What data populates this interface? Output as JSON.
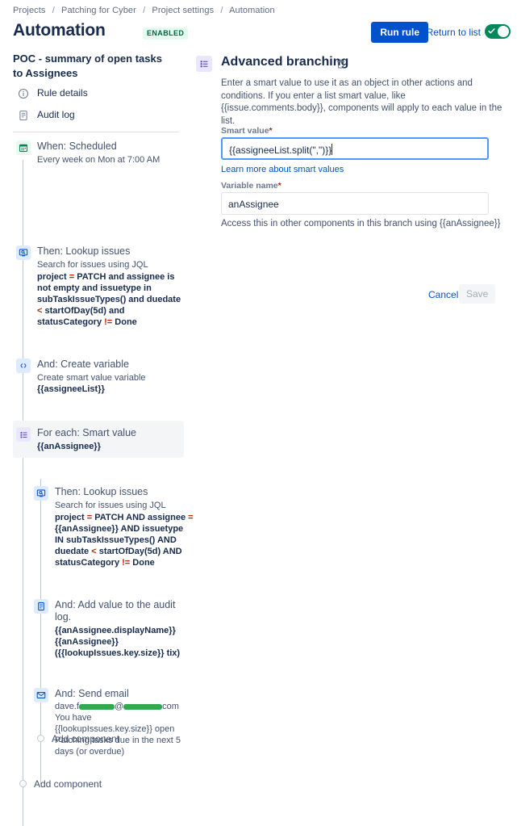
{
  "breadcrumb": {
    "items": [
      "Projects",
      "Patching for Cyber",
      "Project settings",
      "Automation"
    ],
    "separator": "/"
  },
  "header": {
    "title": "Automation",
    "status_badge": "ENABLED",
    "run_rule_label": "Run rule",
    "return_to_list_label": "Return to list",
    "toggle_state": "on",
    "primary_color": "#0052cc",
    "enabled_badge_bg": "#e3fcef",
    "enabled_badge_fg": "#006644",
    "toggle_on_color": "#00875a"
  },
  "rule": {
    "name": "POC - summary of open tasks to Assignees",
    "nav": [
      {
        "label": "Rule details",
        "icon": "info-circle-icon"
      },
      {
        "label": "Audit log",
        "icon": "document-icon"
      }
    ],
    "components": [
      {
        "title": "When: Scheduled",
        "sub": "Every week on Mon at 7:00 AM",
        "icon": "calendar-icon"
      },
      {
        "title": "Then: Lookup issues",
        "sub": "Search for issues using JQL",
        "jql_parts": [
          {
            "t": "project ",
            "op": false
          },
          {
            "t": "=",
            "op": true
          },
          {
            "t": " PATCH and assignee is not empty and issuetype in subTaskIssueTypes() and duedate ",
            "op": false
          },
          {
            "t": "<",
            "op": true
          },
          {
            "t": " startOfDay(5d) and statusCategory ",
            "op": false
          },
          {
            "t": "!=",
            "op": true
          },
          {
            "t": " Done",
            "op": false
          }
        ],
        "icon": "lookup-issues-icon"
      },
      {
        "title": "And: Create variable",
        "sub": "Create smart value variable",
        "strong": "{{assigneeList}}",
        "icon": "curly-braces-icon"
      },
      {
        "title": "For each: Smart value",
        "strong": "{{anAssignee}}",
        "icon": "branching-icon",
        "selected": true
      }
    ],
    "nested_components": [
      {
        "title": "Then: Lookup issues",
        "sub": "Search for issues using JQL",
        "jql_parts": [
          {
            "t": "project ",
            "op": false
          },
          {
            "t": "=",
            "op": true
          },
          {
            "t": " PATCH AND assignee ",
            "op": false
          },
          {
            "t": "=",
            "op": true
          },
          {
            "t": " {{anAssignee}} AND issuetype IN subTaskIssueTypes() AND duedate ",
            "op": false
          },
          {
            "t": "<",
            "op": true
          },
          {
            "t": " startOfDay(5d) AND statusCategory ",
            "op": false
          },
          {
            "t": "!=",
            "op": true
          },
          {
            "t": " Done",
            "op": false
          }
        ],
        "icon": "lookup-issues-icon"
      },
      {
        "title": "And: Add value to the audit log.",
        "strong": "{{anAssignee.displayName}} {{anAssignee}} ({{lookupIssues.key.size}} tix)",
        "icon": "audit-log-icon"
      },
      {
        "title": "And: Send email",
        "email_prefix": "dave.f",
        "email_middle": "@",
        "email_suffix": "com",
        "body": "You have {{lookupIssues.key.size}} open Patching tasks due in the next 5 days (or overdue)",
        "icon": "email-icon"
      }
    ],
    "add_component_nested_label": "Add component",
    "add_component_root_label": "Add component"
  },
  "detail": {
    "title": "Advanced branching",
    "icon": "branching-icon",
    "delete_icon": "trash-icon",
    "description": "Enter a smart value to use it as an object in other actions and conditions. If you enter a list smart value, like {{issue.comments.body}}, components will apply to each value in the list.",
    "smart_value_label": "Smart value",
    "smart_value": "{{assigneeList.split(\",\")}}",
    "smart_value_required": "*",
    "learn_more_label": "Learn more about smart values",
    "variable_name_label": "Variable name",
    "variable_name_required": "*",
    "variable_name": "anAssignee",
    "variable_help": "Access this in other components in this branch using {{anAssignee}}",
    "cancel_label": "Cancel",
    "save_label": "Save",
    "save_disabled": true
  }
}
